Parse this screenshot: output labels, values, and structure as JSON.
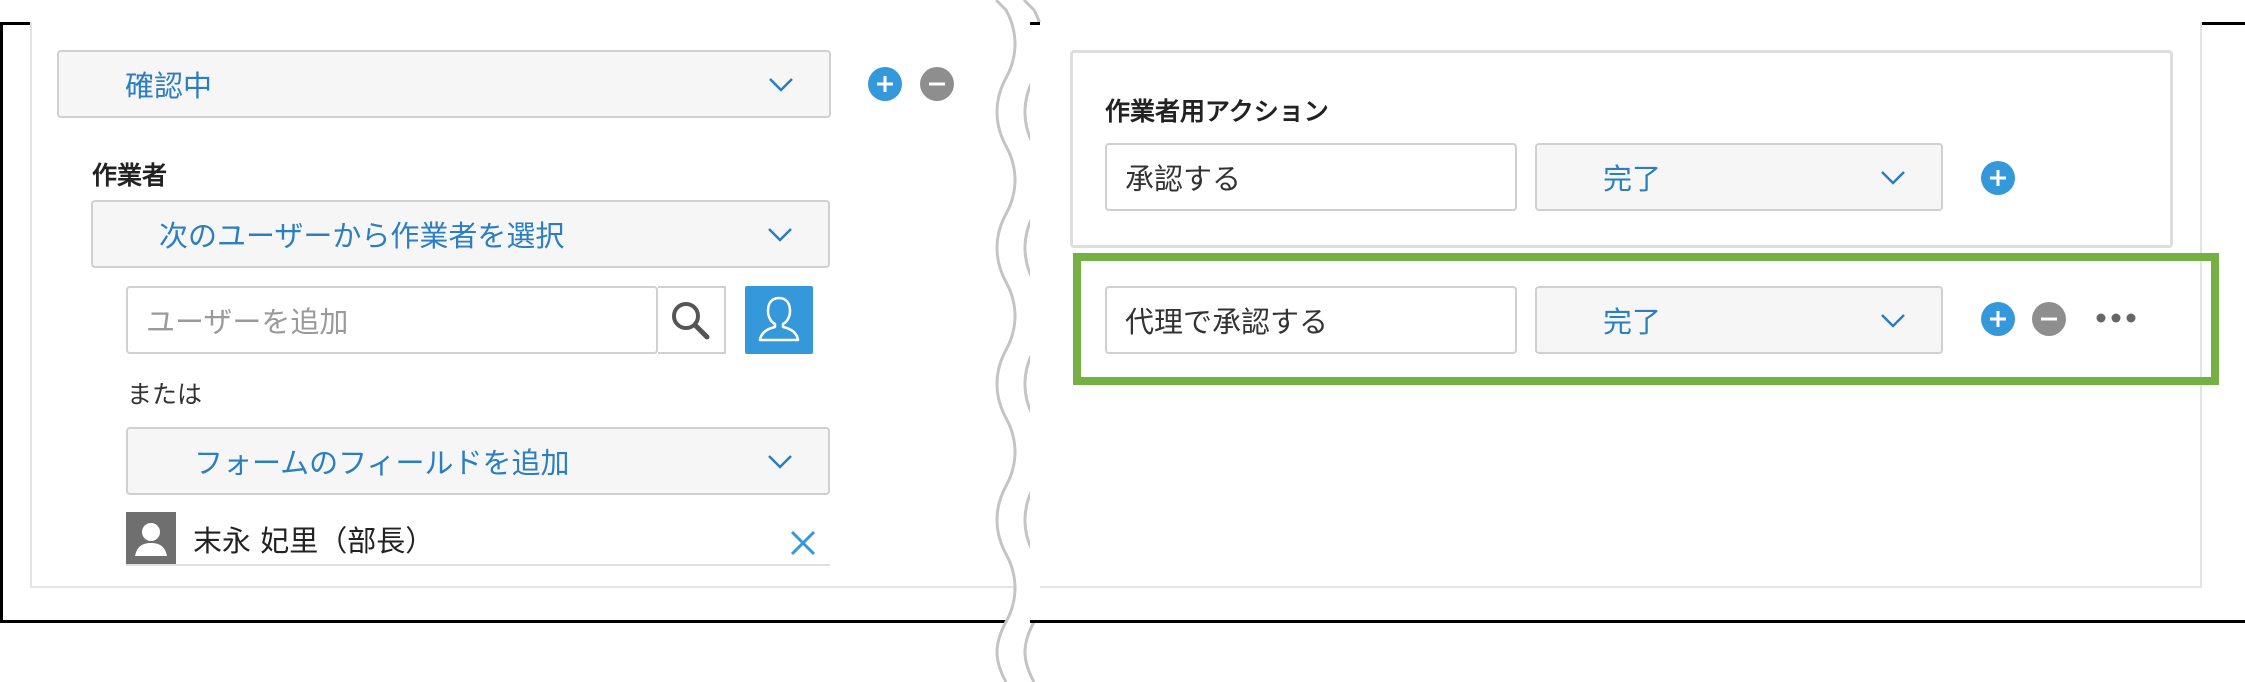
{
  "left_panel": {
    "status_dropdown": {
      "value": "確認中"
    },
    "assignee_label": "作業者",
    "assignee_mode_dropdown": {
      "value": "次のユーザーから作業者を選択"
    },
    "user_search": {
      "placeholder": "ユーザーを追加"
    },
    "or_label": "または",
    "form_field_dropdown": {
      "value": "フォームのフィールドを追加"
    },
    "selected_user": {
      "name": "末永 妃里（部長）"
    }
  },
  "right_panel": {
    "actions_label": "作業者用アクション",
    "actions": [
      {
        "name": "承認する",
        "next_status": "完了"
      },
      {
        "name": "代理で承認する",
        "next_status": "完了"
      }
    ]
  },
  "icons": {
    "plus": "plus-circle-icon",
    "minus": "minus-circle-icon",
    "search": "search-icon",
    "user": "user-icon",
    "close": "close-icon",
    "more": "more-horizontal-icon",
    "chevron": "chevron-down-icon"
  },
  "colors": {
    "accent_blue": "#3498db",
    "link_blue": "#2b7ec1",
    "highlight_green": "#75b043",
    "icon_gray": "#8e8e8e"
  }
}
